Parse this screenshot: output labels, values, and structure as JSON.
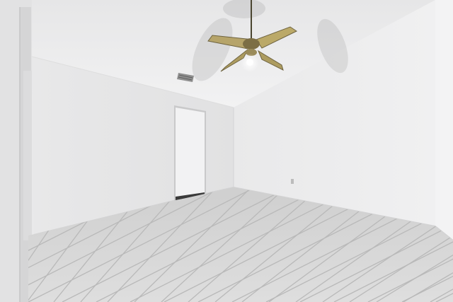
{
  "scene": {
    "type": "photo",
    "description_label": "",
    "palette": {
      "ceiling": "#eeeeef",
      "wall_left": "#e7e7e8",
      "wall_right": "#ececec",
      "back_wall": "#e3e3e4",
      "floor": "#d6d6d6",
      "grout": "#bdbdbd",
      "fan_brass": "#8a7a4a",
      "fan_blade": "#b8a76a",
      "door": "#f1f1f1",
      "trim": "#d9d9da"
    }
  }
}
